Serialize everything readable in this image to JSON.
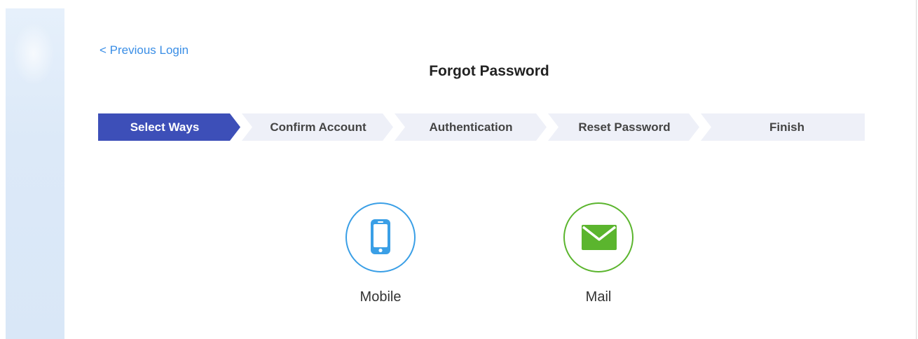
{
  "nav": {
    "previous_login": "< Previous Login"
  },
  "page": {
    "title": "Forgot Password"
  },
  "steps": [
    {
      "label": "Select Ways",
      "active": true
    },
    {
      "label": "Confirm Account",
      "active": false
    },
    {
      "label": "Authentication",
      "active": false
    },
    {
      "label": "Reset Password",
      "active": false
    },
    {
      "label": "Finish",
      "active": false
    }
  ],
  "options": {
    "mobile": {
      "label": "Mobile",
      "icon": "mobile-phone-icon"
    },
    "mail": {
      "label": "Mail",
      "icon": "envelope-icon"
    }
  },
  "colors": {
    "active_step": "#3d4fb8",
    "inactive_step": "#eef0f8",
    "link": "#3a8ee6",
    "mobile_accent": "#3a9fe6",
    "mail_accent": "#5bb52e"
  }
}
